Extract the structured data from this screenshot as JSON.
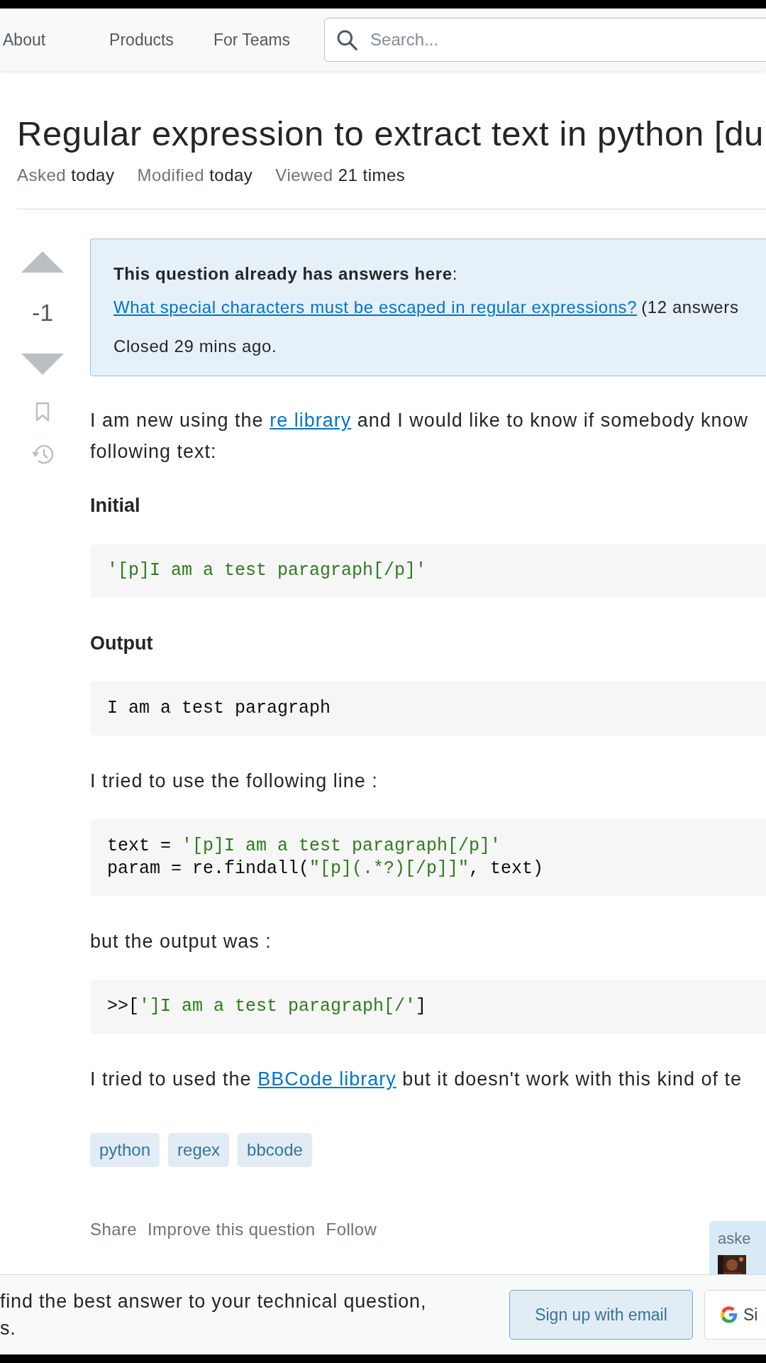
{
  "nav": {
    "links": [
      "About",
      "Products",
      "For Teams"
    ],
    "search": {
      "placeholder": "Search..."
    }
  },
  "question": {
    "title": "Regular expression to extract text in python [du",
    "meta": [
      {
        "label": "Asked",
        "value": "today"
      },
      {
        "label": "Modified",
        "value": "today"
      },
      {
        "label": "Viewed",
        "value": "21 times"
      }
    ],
    "score": "-1",
    "notice": {
      "heading": "**This question already has answers here**:",
      "link": "What special characters must be escaped in regular expressions?",
      "count": "(12 answers",
      "closed": "Closed 29 mins ago."
    },
    "body": [
      {
        "kind": "paragraph",
        "lines": [
          [
            {
              "text": "I am new using the ",
              "link": false
            },
            {
              "text": "re library",
              "link": true
            },
            {
              "text": " and I would like to know if somebody know",
              "link": false
            }
          ],
          [
            {
              "text": "following text:",
              "link": false
            }
          ]
        ]
      },
      {
        "kind": "heading",
        "text": "Initial"
      },
      {
        "kind": "code",
        "lines": [
          [
            {
              "text": "'[p]I am a test paragraph[/p]'",
              "string": true
            }
          ]
        ]
      },
      {
        "kind": "heading",
        "text": "Output"
      },
      {
        "kind": "code",
        "lines": [
          [
            {
              "text": "I am a test paragraph",
              "string": false
            }
          ]
        ]
      },
      {
        "kind": "paragraph",
        "lines": [
          [
            {
              "text": "I tried to use the following line :",
              "link": false
            }
          ]
        ]
      },
      {
        "kind": "code",
        "lines": [
          [
            {
              "text": "text = ",
              "string": false
            },
            {
              "text": "'[p]I am a test paragraph[/p]'",
              "string": true
            }
          ],
          [
            {
              "text": "param = re.findall(",
              "string": false
            },
            {
              "text": "\"[p](.*?)[/p]]\"",
              "string": true
            },
            {
              "text": ", text)",
              "string": false
            }
          ]
        ]
      },
      {
        "kind": "paragraph",
        "lines": [
          [
            {
              "text": "but the output was :",
              "link": false
            }
          ]
        ]
      },
      {
        "kind": "code",
        "lines": [
          [
            {
              "text": ">>[",
              "string": false
            },
            {
              "text": "']I am a test paragraph[/'",
              "string": true
            },
            {
              "text": "]",
              "string": false
            }
          ]
        ]
      },
      {
        "kind": "paragraph",
        "lines": [
          [
            {
              "text": "I tried to used the ",
              "link": false
            },
            {
              "text": "BBCode library",
              "link": true
            },
            {
              "text": " but it doesn't work with this kind of te",
              "link": false
            }
          ]
        ]
      }
    ],
    "tags": [
      "python",
      "regex",
      "bbcode"
    ],
    "post_menu": [
      "Share",
      "Improve this question",
      "Follow"
    ],
    "asked_card": {
      "label": "aske"
    }
  },
  "banner": {
    "lines": [
      "find the best answer to your technical question,",
      "s."
    ],
    "buttons": [
      {
        "kind": "email",
        "label": "Sign up with email"
      },
      {
        "kind": "google",
        "label": "Si"
      }
    ]
  }
}
